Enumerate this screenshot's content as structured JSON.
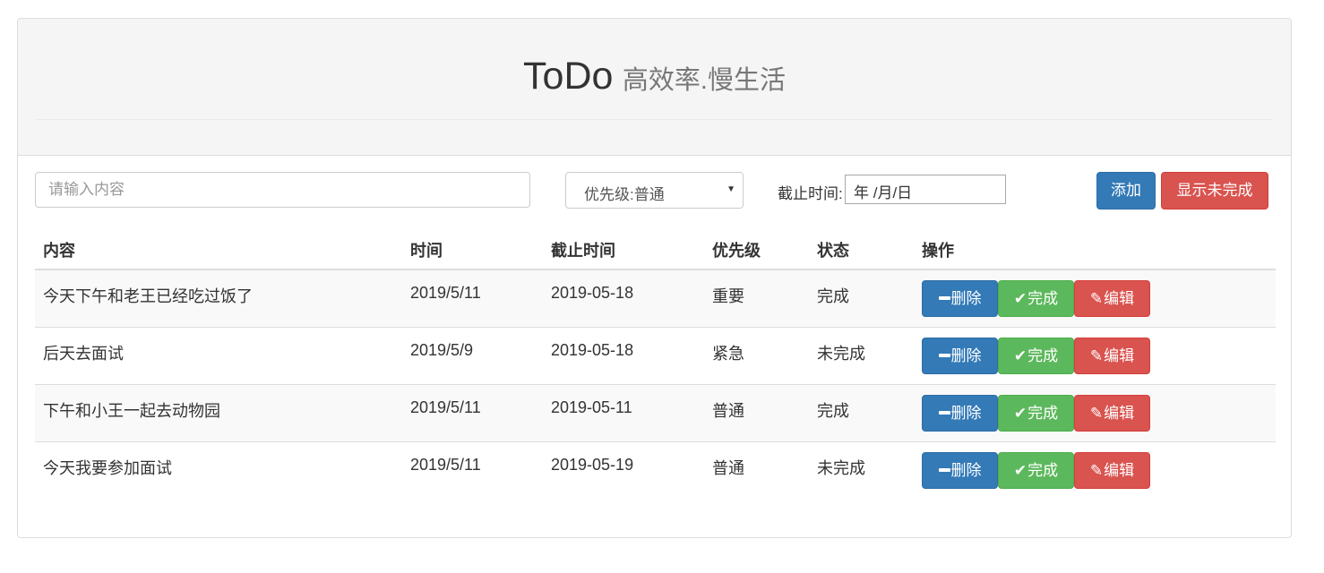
{
  "header": {
    "title": "ToDo",
    "subtitle": "高效率.慢生活"
  },
  "form": {
    "content_placeholder": "请输入内容",
    "priority_selected": "优先级:普通",
    "deadline_label": "截止时间:",
    "deadline_value": "年 /月/日",
    "add_label": "添加",
    "show_unfinished_label": "显示未完成"
  },
  "table": {
    "headers": [
      "内容",
      "时间",
      "截止时间",
      "优先级",
      "状态",
      "操作"
    ],
    "rows": [
      {
        "content": "今天下午和老王已经吃过饭了",
        "time": "2019/5/11",
        "deadline": "2019-05-18",
        "priority": "重要",
        "status": "完成"
      },
      {
        "content": "后天去面试",
        "time": "2019/5/9",
        "deadline": "2019-05-18",
        "priority": "紧急",
        "status": "未完成"
      },
      {
        "content": "下午和小王一起去动物园",
        "time": "2019/5/11",
        "deadline": "2019-05-11",
        "priority": "普通",
        "status": "完成"
      },
      {
        "content": "今天我要参加面试",
        "time": "2019/5/11",
        "deadline": "2019-05-19",
        "priority": "普通",
        "status": "未完成"
      }
    ],
    "actions": {
      "delete_label": "删除",
      "done_label": "完成",
      "edit_label": "编辑"
    }
  },
  "icons": {
    "delete": "minus-icon",
    "done": "check-icon",
    "edit": "pencil-icon"
  },
  "colors": {
    "primary": "#337ab7",
    "success": "#5cb85c",
    "danger": "#d9534f"
  }
}
